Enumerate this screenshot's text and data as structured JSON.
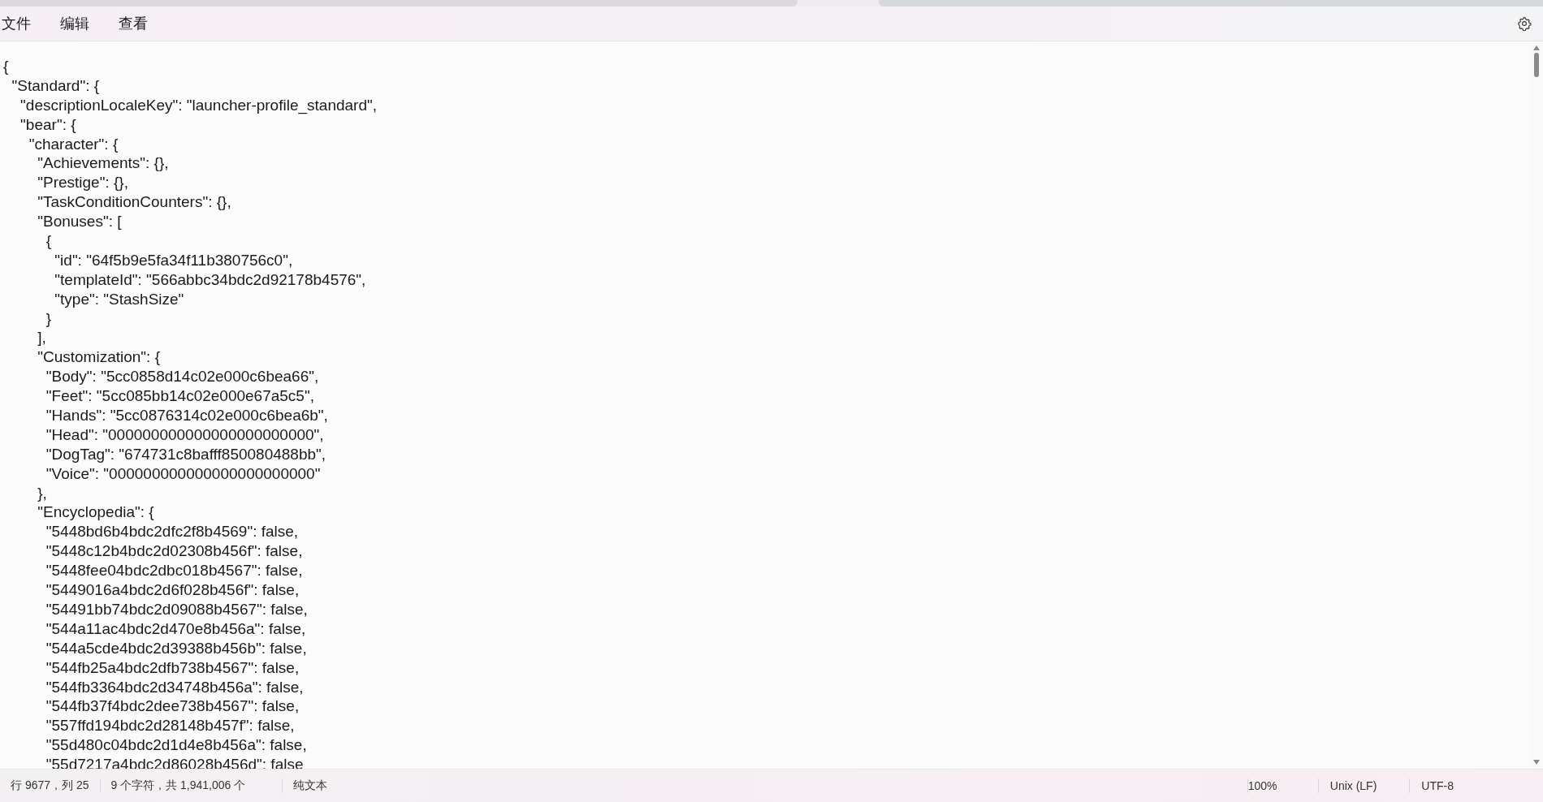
{
  "menu": [
    "文件",
    "编辑",
    "查看"
  ],
  "editor": {
    "lines": [
      "{",
      "  \"Standard\": {",
      "    \"descriptionLocaleKey\": \"launcher-profile_standard\",",
      "    \"bear\": {",
      "      \"character\": {",
      "        \"Achievements\": {},",
      "        \"Prestige\": {},",
      "        \"TaskConditionCounters\": {},",
      "        \"Bonuses\": [",
      "          {",
      "            \"id\": \"64f5b9e5fa34f11b380756c0\",",
      "            \"templateId\": \"566abbc34bdc2d92178b4576\",",
      "            \"type\": \"StashSize\"",
      "          }",
      "        ],",
      "        \"Customization\": {",
      "          \"Body\": \"5cc0858d14c02e000c6bea66\",",
      "          \"Feet\": \"5cc085bb14c02e000e67a5c5\",",
      "          \"Hands\": \"5cc0876314c02e000c6bea6b\",",
      "          \"Head\": \"000000000000000000000000\",",
      "          \"DogTag\": \"674731c8bafff850080488bb\",",
      "          \"Voice\": \"000000000000000000000000\"",
      "        },",
      "        \"Encyclopedia\": {",
      "          \"5448bd6b4bdc2dfc2f8b4569\": false,",
      "          \"5448c12b4bdc2d02308b456f\": false,",
      "          \"5448fee04bdc2dbc018b4567\": false,",
      "          \"5449016a4bdc2d6f028b456f\": false,",
      "          \"54491bb74bdc2d09088b4567\": false,",
      "          \"544a11ac4bdc2d470e8b456a\": false,",
      "          \"544a5cde4bdc2d39388b456b\": false,",
      "          \"544fb25a4bdc2dfb738b4567\": false,",
      "          \"544fb3364bdc2d34748b456a\": false,",
      "          \"544fb37f4bdc2dee738b4567\": false,",
      "          \"557ffd194bdc2d28148b457f\": false,",
      "          \"55d480c04bdc2d1d4e8b456a\": false,",
      "          \"55d7217a4bdc2d86028b456d\": false"
    ]
  },
  "status_bar": {
    "position": "行 9677，列 25",
    "selection": "9 个字符，共 1,941,006 个",
    "format": "纯文本",
    "zoom": "100%",
    "line_ending": "Unix (LF)",
    "encoding": "UTF-8"
  }
}
